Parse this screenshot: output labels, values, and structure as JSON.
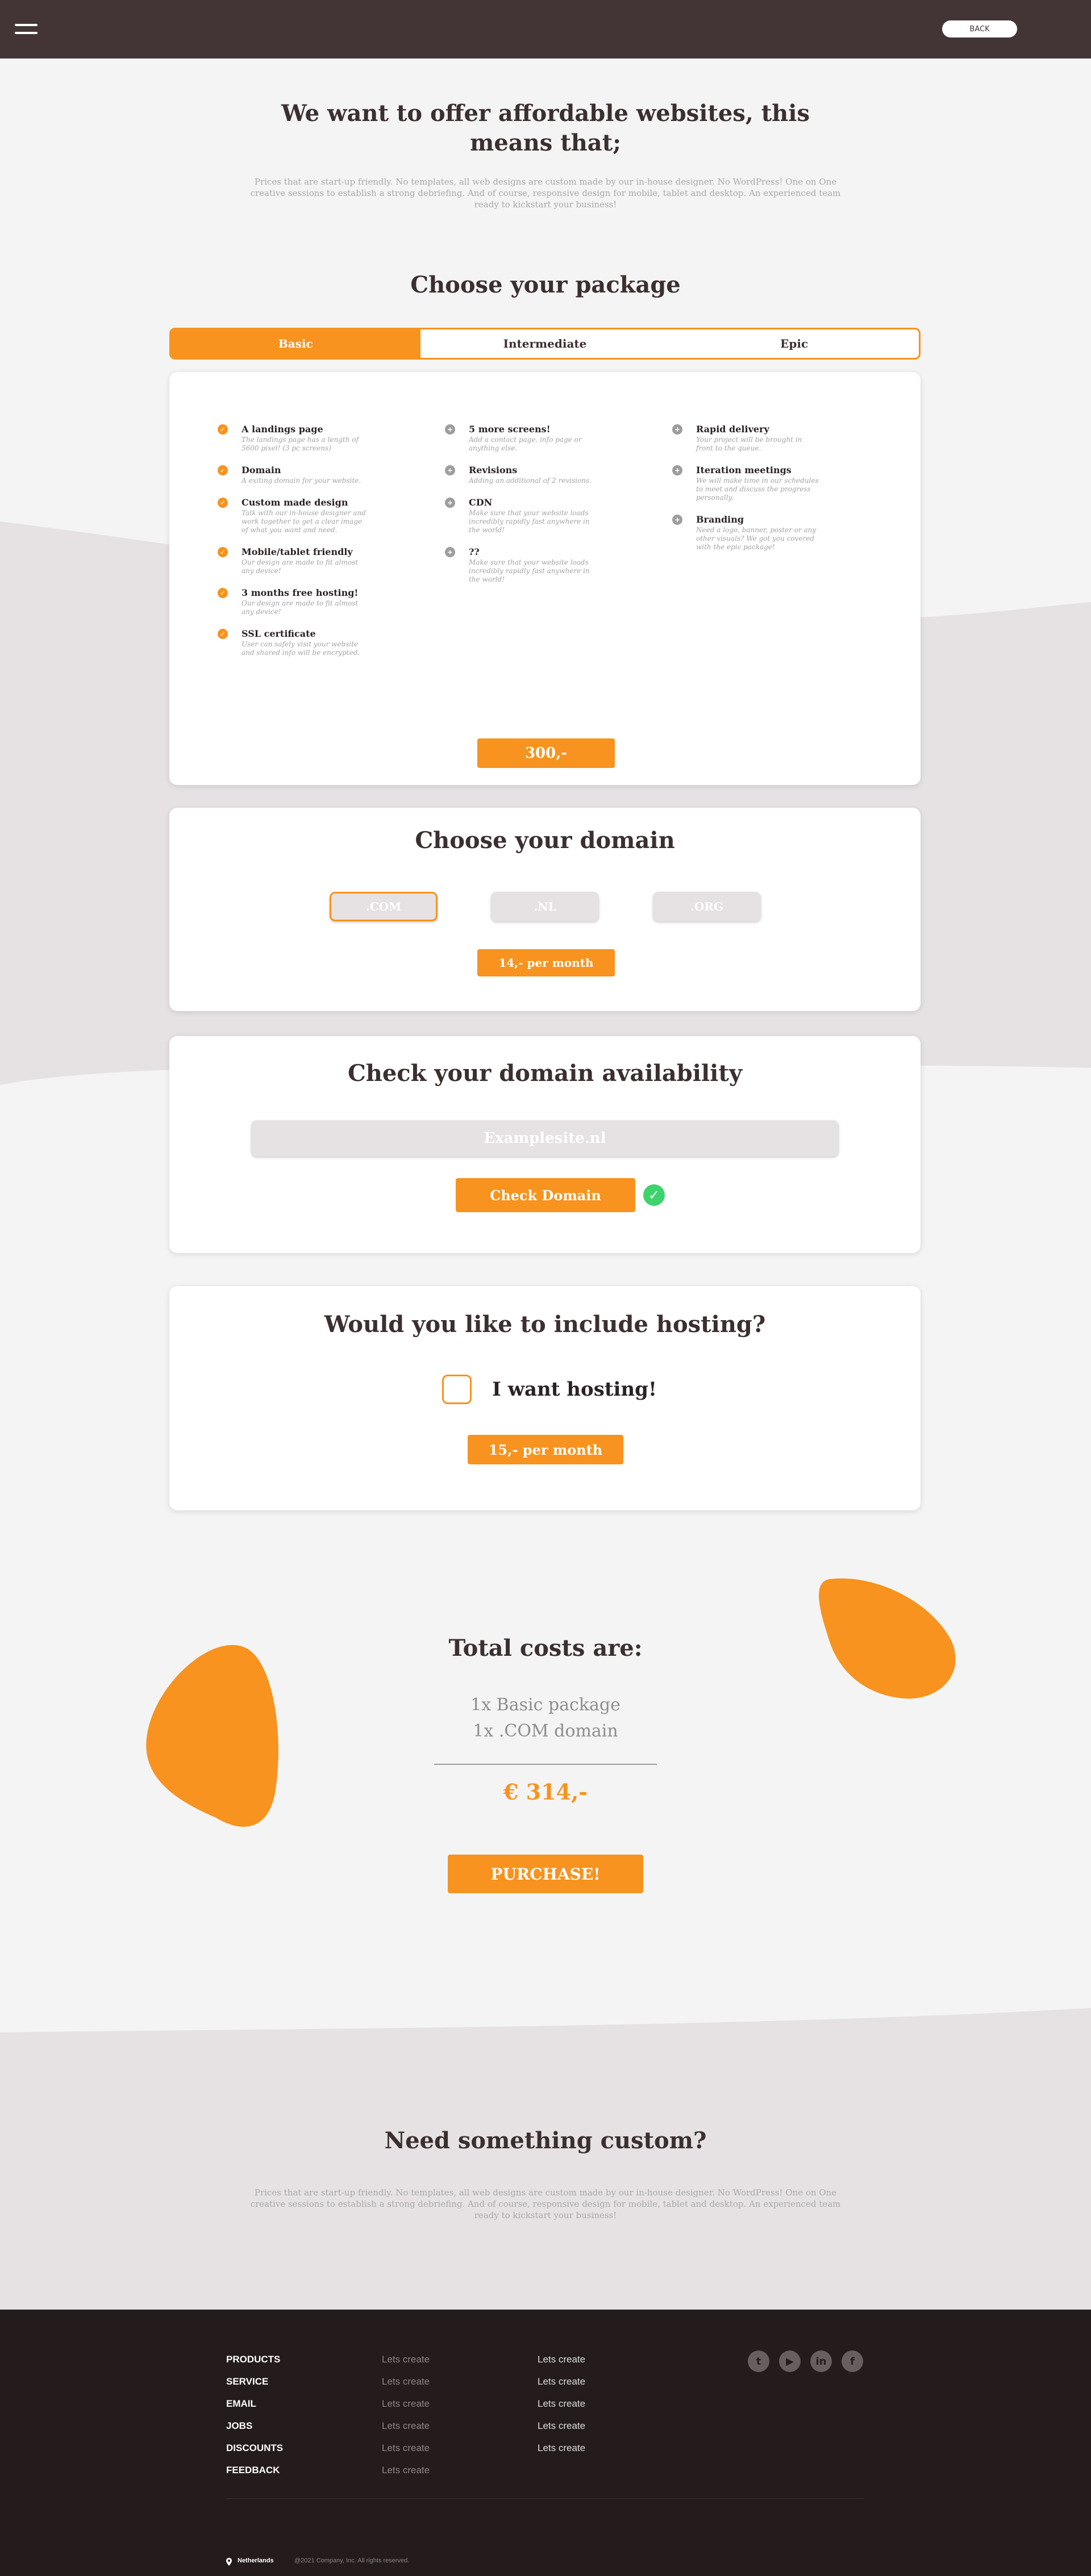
{
  "colors": {
    "accent": "#f7931e",
    "header_bg": "#433536",
    "footer_bg": "#231b1c",
    "success": "#3ed36d"
  },
  "header": {
    "menu_icon": "hamburger-icon",
    "back_label": "BACK"
  },
  "intro": {
    "title": "We want to offer affordable websites, this means that;",
    "text": "Prices that are start-up friendly. No templates, all web designs are custom made by our in-house designer. No WordPress! One on One creative sessions to establish a strong debriefing. And of course, responsive design for mobile, tablet and desktop. An experienced team ready to kickstart your business!"
  },
  "package": {
    "title": "Choose your package",
    "tabs": [
      {
        "label": "Basic"
      },
      {
        "label": "Intermediate"
      },
      {
        "label": "Epic"
      }
    ],
    "active_tab": "Basic",
    "columns": [
      [
        {
          "icon": "check-icon",
          "title": "A landings page",
          "desc": "The landings page has a length of 5600 pixel! (3 pc screens)"
        },
        {
          "icon": "check-icon",
          "title": "Domain",
          "desc": "A exiting domain for your website."
        },
        {
          "icon": "check-icon",
          "title": "Custom made design",
          "desc": "Talk with our in-house designer and work together to get a clear image of what you want and need."
        },
        {
          "icon": "check-icon",
          "title": "Mobile/tablet friendly",
          "desc": "Our design are made to fit almost any device!"
        },
        {
          "icon": "check-icon",
          "title": "3 months free hosting!",
          "desc": "Our design are made to fit almost any device!"
        },
        {
          "icon": "check-icon",
          "title": "SSL certificate",
          "desc": "User can safely visit your website and shared info will be encrypted."
        }
      ],
      [
        {
          "icon": "plus-icon",
          "title": "5 more screens!",
          "desc": "Add a contact page, info page or anything else."
        },
        {
          "icon": "plus-icon",
          "title": "Revisions",
          "desc": "Adding an additional of 2 revisions."
        },
        {
          "icon": "plus-icon",
          "title": "CDN",
          "desc": "Make sure that your website loads incredibly rapidly fast anywhere in the world!"
        },
        {
          "icon": "plus-icon",
          "title": "??",
          "desc": "Make sure that your website loads incredibly rapidly fast anywhere in the world!"
        }
      ],
      [
        {
          "icon": "plus-icon",
          "title": "Rapid delivery",
          "desc": "Your project will be brought in front to the queue."
        },
        {
          "icon": "plus-icon",
          "title": "Iteration meetings",
          "desc": "We will make time in our schedules to meet and discuss the progress personally."
        },
        {
          "icon": "plus-icon",
          "title": "Branding",
          "desc": "Need a logo, banner, poster or any other visuals? We got you covered with the epic package!"
        }
      ]
    ],
    "price": "300,-"
  },
  "domain": {
    "title": "Choose your domain",
    "options": [
      {
        "label": ".COM"
      },
      {
        "label": ".NL"
      },
      {
        "label": ".ORG"
      }
    ],
    "selected": ".COM",
    "price": "14,- per month"
  },
  "availability": {
    "title": "Check your domain availability",
    "placeholder": "Examplesite.nl",
    "button": "Check Domain",
    "status_icon": "check-circle-icon"
  },
  "hosting": {
    "title": "Would you like to include hosting?",
    "checkbox_label": "I want hosting!",
    "checked": false,
    "price": "15,- per month"
  },
  "totals": {
    "title": "Total costs are:",
    "items": [
      "1x Basic package",
      "1x .COM domain"
    ],
    "total": "€ 314,-",
    "purchase": "PURCHASE!"
  },
  "custom": {
    "title": "Need something custom?",
    "text": "Prices that are start-up friendly. No templates, all web designs are custom made by our in-house designer. No WordPress! One on One creative sessions to establish a strong debriefing. And of course, responsive design for mobile, tablet and desktop. An experienced team ready to kickstart your business!"
  },
  "footer": {
    "col1": [
      "PRODUCTS",
      "SERVICE",
      "EMAIL",
      "JOBS",
      "DISCOUNTS",
      "FEEDBACK"
    ],
    "col2": [
      "Lets create",
      "Lets create",
      "Lets create",
      "Lets create",
      "Lets create",
      "Lets create"
    ],
    "col3": [
      "Lets create",
      "Lets create",
      "Lets create",
      "Lets create",
      "Lets create"
    ],
    "social": [
      {
        "icon": "twitter-icon",
        "glyph": "t"
      },
      {
        "icon": "youtube-icon",
        "glyph": "▶"
      },
      {
        "icon": "linkedin-icon",
        "glyph": "in"
      },
      {
        "icon": "facebook-icon",
        "glyph": "f"
      }
    ],
    "location": "Netherlands",
    "copyright": "@2021 Company, Inc. All rights reserved."
  }
}
